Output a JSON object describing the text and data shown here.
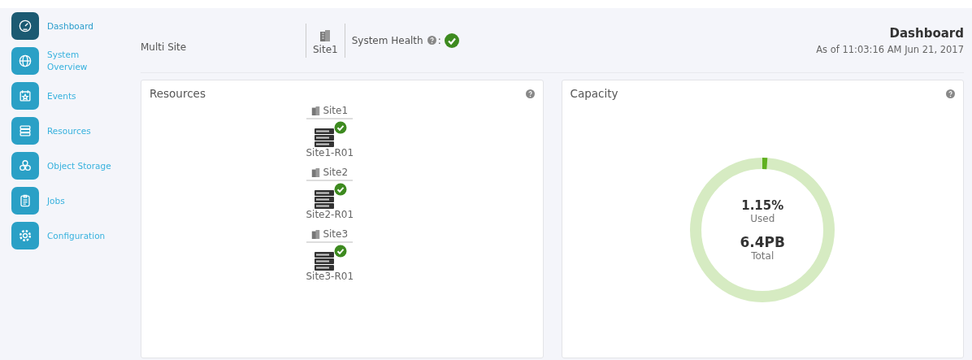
{
  "sidebar": {
    "items": [
      {
        "label": "Dashboard",
        "kind": "gauge",
        "selected": true
      },
      {
        "label": "System Overview",
        "kind": "globe",
        "selected": false
      },
      {
        "label": "Events",
        "kind": "calendar",
        "selected": false
      },
      {
        "label": "Resources",
        "kind": "stack",
        "selected": false
      },
      {
        "label": "Object Storage",
        "kind": "circles",
        "selected": false
      },
      {
        "label": "Jobs",
        "kind": "clipboard",
        "selected": false
      },
      {
        "label": "Configuration",
        "kind": "gear",
        "selected": false
      }
    ]
  },
  "header": {
    "scope": "Multi Site",
    "site": "Site1",
    "health_label": "System Health",
    "health_separator": ":",
    "health_ok": true,
    "title": "Dashboard",
    "timestamp": "As of 11:03:16 AM Jun 21, 2017"
  },
  "resources": {
    "title": "Resources",
    "sites": [
      {
        "name": "Site1",
        "node": "Site1-R01",
        "ok": true
      },
      {
        "name": "Site2",
        "node": "Site2-R01",
        "ok": true
      },
      {
        "name": "Site3",
        "node": "Site3-R01",
        "ok": true
      }
    ]
  },
  "capacity": {
    "title": "Capacity",
    "level": 0.0115,
    "used_value": "1.15%",
    "used_label": "Used",
    "total_value": "6.4PB",
    "total_label": "Total"
  }
}
